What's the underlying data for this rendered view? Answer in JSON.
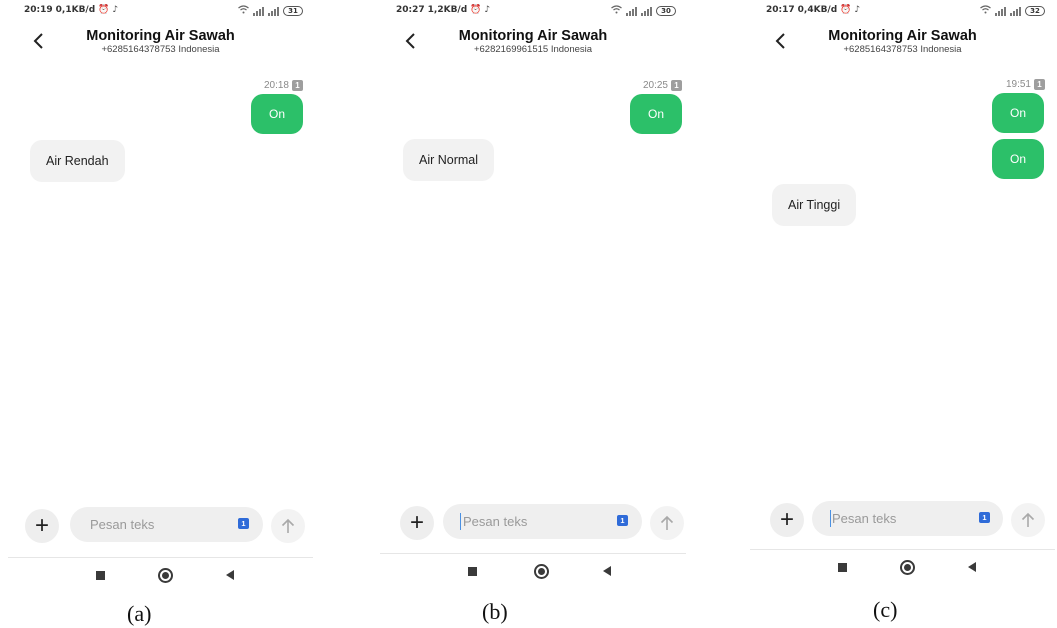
{
  "panels": [
    {
      "status": {
        "time": "20:19",
        "speed": "0,1KB/d",
        "battery": "31"
      },
      "header": {
        "contact": "Monitoring Air Sawah",
        "number": "+6285164378753 Indonesia"
      },
      "sent": {
        "time": "20:18",
        "sim": "1",
        "messages": [
          "On"
        ]
      },
      "received": [
        "Air Rendah"
      ],
      "composer": {
        "placeholder": "Pesan teks",
        "sim": "1"
      },
      "caption": "(a)"
    },
    {
      "status": {
        "time": "20:27",
        "speed": "1,2KB/d",
        "battery": "30"
      },
      "header": {
        "contact": "Monitoring Air Sawah",
        "number": "+6282169961515 Indonesia"
      },
      "sent": {
        "time": "20:25",
        "sim": "1",
        "messages": [
          "On"
        ]
      },
      "received": [
        "Air Normal"
      ],
      "composer": {
        "placeholder": "Pesan teks",
        "sim": "1"
      },
      "caption": "(b)"
    },
    {
      "status": {
        "time": "20:17",
        "speed": "0,4KB/d",
        "battery": "32"
      },
      "header": {
        "contact": "Monitoring Air Sawah",
        "number": "+6285164378753 Indonesia"
      },
      "sent": {
        "time": "19:51",
        "sim": "1",
        "messages": [
          "On",
          "On"
        ]
      },
      "received": [
        "Air Tinggi"
      ],
      "composer": {
        "placeholder": "Pesan teks",
        "sim": "1"
      },
      "caption": "(c)"
    }
  ],
  "colors": {
    "sent_bubble": "#2cc069",
    "received_bubble": "#f2f2f2",
    "sim_chip": "#2f6bd8"
  },
  "icons": {
    "back": "back-arrow-icon",
    "status_left": [
      "alarm-icon",
      "tiktok-icon"
    ],
    "status_right": [
      "wifi-icon",
      "signal-icon",
      "signal-icon",
      "battery-icon"
    ],
    "attach": "plus-icon",
    "send": "arrow-up-icon",
    "nav": [
      "recent-apps-icon",
      "home-icon",
      "back-icon"
    ]
  }
}
